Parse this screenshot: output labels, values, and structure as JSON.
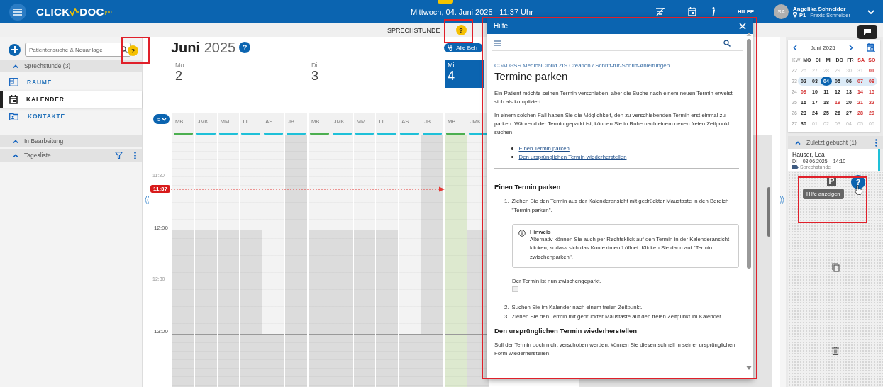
{
  "topbar": {
    "logo_left": "CLICK",
    "logo_right": "DOC",
    "logo_badge": "pro",
    "datetime": "Mittwoch, 04. Juni 2025 - 11:37 Uhr",
    "help_label": "HILFE",
    "avatar": "SA",
    "user_name": "Angelika Schneider",
    "location_code": "P1",
    "practice": "Praxis Schneider"
  },
  "subbar": {
    "title": "SPRECHSTUNDE",
    "help": "?"
  },
  "sidebar": {
    "search": {
      "placeholder": "Patientensuche & Neuanlage"
    },
    "search_help": "?",
    "sections": [
      {
        "label": "Sprechstunde (3)",
        "expanded": true
      }
    ],
    "nav": [
      {
        "label": "RÄUME",
        "selected": false,
        "kind": "rooms"
      },
      {
        "label": "KALENDER",
        "selected": true,
        "kind": "calendar"
      },
      {
        "label": "KONTAKTE",
        "selected": false,
        "kind": "contacts"
      }
    ],
    "panels": [
      {
        "label": "In Bearbeitung",
        "expanded": true,
        "tools": false
      },
      {
        "label": "Tagesliste",
        "expanded": true,
        "tools": true
      }
    ]
  },
  "calendar": {
    "month": "Juni",
    "year": "2025",
    "help": "?",
    "filter_button": "Alle Beh",
    "staff_count": "5",
    "days": [
      {
        "weekday": "Mo",
        "date": "2",
        "selected": false,
        "columns": [
          {
            "label": "MB",
            "color": "#4caf50",
            "kind": "standard"
          },
          {
            "label": "JMK",
            "color": "#1ec0d8",
            "kind": "standard"
          },
          {
            "label": "MM",
            "color": "#1ec0d8",
            "kind": "standard"
          },
          {
            "label": "LL",
            "color": "#1ec0d8",
            "kind": "standard"
          },
          {
            "label": "AS",
            "color": "#1ec0d8",
            "kind": "extended"
          },
          {
            "label": "JB",
            "color": "#1ec0d8",
            "kind": "absent"
          }
        ]
      },
      {
        "weekday": "Di",
        "date": "3",
        "selected": false,
        "columns": [
          {
            "label": "MB",
            "color": "#4caf50",
            "kind": "standard"
          },
          {
            "label": "JMK",
            "color": "#1ec0d8",
            "kind": "standard"
          },
          {
            "label": "MM",
            "color": "#1ec0d8",
            "kind": "standard"
          },
          {
            "label": "LL",
            "color": "#1ec0d8",
            "kind": "standard"
          },
          {
            "label": "AS",
            "color": "#1ec0d8",
            "kind": "extended"
          },
          {
            "label": "JB",
            "color": "#1ec0d8",
            "kind": "absent"
          }
        ]
      },
      {
        "weekday": "Mi",
        "date": "4",
        "selected": true,
        "columns": [
          {
            "label": "MB",
            "color": "#4caf50",
            "kind": "highlight"
          },
          {
            "label": "JMK",
            "color": "#1ec0d8",
            "kind": "standard"
          }
        ]
      }
    ],
    "times": [
      {
        "label": "11:30",
        "kind": "minor"
      },
      {
        "label": "12:00",
        "kind": "hour"
      },
      {
        "label": "12:30",
        "kind": "minor"
      },
      {
        "label": "13:00",
        "kind": "hour"
      }
    ],
    "now": "11:37"
  },
  "mini_calendar": {
    "title": "Juni 2025",
    "headers": [
      {
        "label": "KW",
        "kind": "week"
      },
      {
        "label": "MO",
        "kind": "day"
      },
      {
        "label": "DI",
        "kind": "day"
      },
      {
        "label": "MI",
        "kind": "day"
      },
      {
        "label": "DO",
        "kind": "day"
      },
      {
        "label": "FR",
        "kind": "day"
      },
      {
        "label": "SA",
        "kind": "holiday"
      },
      {
        "label": "SO",
        "kind": "holiday"
      }
    ],
    "weeks": [
      {
        "week": "22",
        "selected": false,
        "days": [
          {
            "label": "26",
            "kind": "other",
            "selected": false
          },
          {
            "label": "27",
            "kind": "other",
            "selected": false
          },
          {
            "label": "28",
            "kind": "other",
            "selected": false
          },
          {
            "label": "29",
            "kind": "other",
            "selected": false
          },
          {
            "label": "30",
            "kind": "other",
            "selected": false
          },
          {
            "label": "31",
            "kind": "other",
            "selected": false
          },
          {
            "label": "01",
            "kind": "holiday",
            "selected": false
          }
        ]
      },
      {
        "week": "23",
        "selected": true,
        "days": [
          {
            "label": "02",
            "kind": "day",
            "selected": false
          },
          {
            "label": "03",
            "kind": "day",
            "selected": false
          },
          {
            "label": "04",
            "kind": "day",
            "selected": true
          },
          {
            "label": "05",
            "kind": "day",
            "selected": false
          },
          {
            "label": "06",
            "kind": "day",
            "selected": false
          },
          {
            "label": "07",
            "kind": "holiday",
            "selected": false
          },
          {
            "label": "08",
            "kind": "holiday",
            "selected": false
          }
        ]
      },
      {
        "week": "24",
        "selected": false,
        "days": [
          {
            "label": "09",
            "kind": "holiday",
            "selected": false
          },
          {
            "label": "10",
            "kind": "day",
            "selected": false
          },
          {
            "label": "11",
            "kind": "day",
            "selected": false
          },
          {
            "label": "12",
            "kind": "day",
            "selected": false
          },
          {
            "label": "13",
            "kind": "day",
            "selected": false
          },
          {
            "label": "14",
            "kind": "holiday",
            "selected": false
          },
          {
            "label": "15",
            "kind": "holiday",
            "selected": false
          }
        ]
      },
      {
        "week": "25",
        "selected": false,
        "days": [
          {
            "label": "16",
            "kind": "day",
            "selected": false
          },
          {
            "label": "17",
            "kind": "day",
            "selected": false
          },
          {
            "label": "18",
            "kind": "day",
            "selected": false
          },
          {
            "label": "19",
            "kind": "holiday",
            "selected": false
          },
          {
            "label": "20",
            "kind": "day",
            "selected": false
          },
          {
            "label": "21",
            "kind": "holiday",
            "selected": false
          },
          {
            "label": "22",
            "kind": "holiday",
            "selected": false
          }
        ]
      },
      {
        "week": "26",
        "selected": false,
        "days": [
          {
            "label": "23",
            "kind": "day",
            "selected": false
          },
          {
            "label": "24",
            "kind": "day",
            "selected": false
          },
          {
            "label": "25",
            "kind": "day",
            "selected": false
          },
          {
            "label": "26",
            "kind": "day",
            "selected": false
          },
          {
            "label": "27",
            "kind": "day",
            "selected": false
          },
          {
            "label": "28",
            "kind": "holiday",
            "selected": false
          },
          {
            "label": "29",
            "kind": "holiday",
            "selected": false
          }
        ]
      },
      {
        "week": "27",
        "selected": false,
        "days": [
          {
            "label": "30",
            "kind": "day",
            "selected": false
          },
          {
            "label": "01",
            "kind": "other",
            "selected": false
          },
          {
            "label": "02",
            "kind": "other",
            "selected": false
          },
          {
            "label": "03",
            "kind": "other",
            "selected": false
          },
          {
            "label": "04",
            "kind": "other",
            "selected": false
          },
          {
            "label": "05",
            "kind": "other",
            "selected": false
          },
          {
            "label": "06",
            "kind": "other",
            "selected": false
          }
        ]
      }
    ]
  },
  "recent": {
    "title": "Zuletzt gebucht (1)",
    "entries": [
      {
        "name": "Hauser, Lea",
        "weekday": "Di",
        "date": "03.06.2025",
        "time": "14:10",
        "type": "Sprechstunde"
      }
    ]
  },
  "parking": {
    "help": "?",
    "tooltip": "Hilfe anzeigen"
  },
  "help_panel": {
    "title": "Hilfe",
    "breadcrumb": "CGM GSS MedicalCloud ZIS Creation / Schritt-für-Schritt-Anleitungen",
    "heading": "Termine parken",
    "blocks": [
      {
        "kind": "paragraph",
        "text": "Ein Patient möchte seinen Termin verschieben, aber die Suche nach einem neuen Termin erweist sich als kompliziert."
      },
      {
        "kind": "paragraph",
        "text": "In einem solchen Fall haben Sie die Möglichkeit, den zu verschiebenden Termin erst einmal zu parken. Während der Termin geparkt ist, können Sie in Ruhe nach einem neuen freien Zeitpunkt suchen."
      },
      {
        "kind": "links",
        "items": [
          "Einen Termin parken",
          "Den ursprünglichen Termin wiederherstellen"
        ]
      },
      {
        "kind": "rule"
      },
      {
        "kind": "section",
        "text": "Einen Termin parken"
      },
      {
        "kind": "step",
        "number": "1.",
        "text": "Ziehen Sie den Termin aus der Kalenderansicht mit gedrückter Maustaste in den Bereich \"Termin parken\"."
      },
      {
        "kind": "note",
        "title": "Hinweis",
        "text": "Alternativ können Sie auch per Rechtsklick auf den Termin in der Kalenderansicht klicken, sodass sich das Kontextmenü öffnet. Klicken Sie dann auf \"Termin zwischenparken\"."
      },
      {
        "kind": "indented",
        "text": "Der Termin ist nun zwischengeparkt."
      },
      {
        "kind": "step",
        "number": "2.",
        "text": "Suchen Sie im Kalender nach einem freien Zeitpunkt."
      },
      {
        "kind": "step",
        "number": "3.",
        "text": "Ziehen Sie den Termin mit gedrückter Maustaste auf den freien Zeitpunkt im Kalender."
      },
      {
        "kind": "section",
        "text": "Den ursprünglichen Termin wiederherstellen"
      },
      {
        "kind": "paragraph",
        "text": "Soll der Termin doch nicht verschoben werden, können Sie diesen schnell in seiner ursprünglichen Form wiederherstellen."
      }
    ]
  }
}
